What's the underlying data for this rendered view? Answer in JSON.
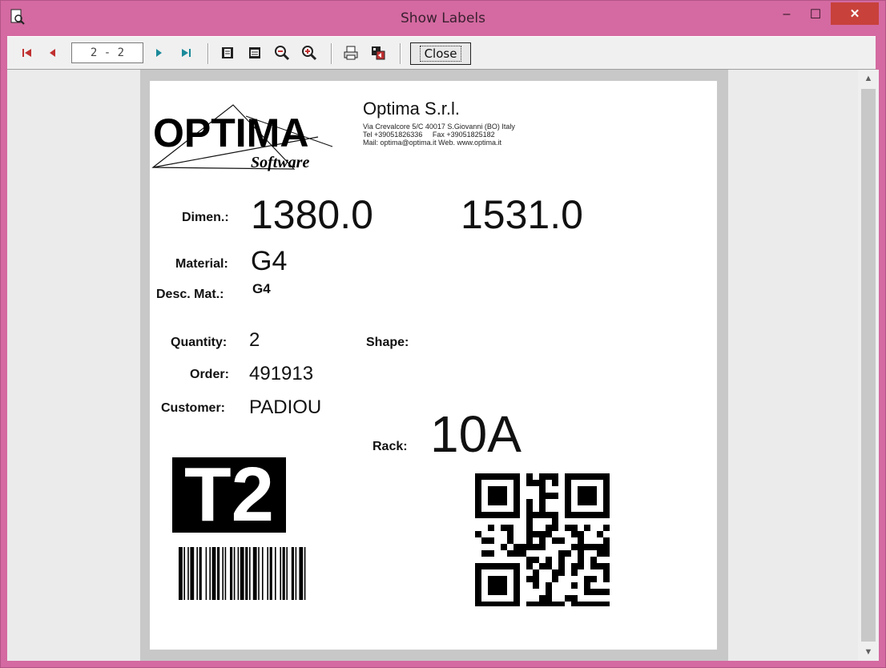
{
  "window": {
    "title": "Show Labels",
    "minimize_glyph": "–",
    "maximize_glyph": "☐",
    "close_glyph": "✕"
  },
  "toolbar": {
    "page_indicator": "2 - 2",
    "close_label": "Close",
    "icons": [
      "first-page-icon",
      "prev-page-icon",
      "next-page-icon",
      "last-page-icon",
      "fit-page-icon",
      "fit-width-icon",
      "zoom-out-icon",
      "zoom-in-icon",
      "print-icon",
      "export-icon"
    ]
  },
  "label": {
    "company": {
      "logo_text": "OPTIMA",
      "logo_sub": "Software",
      "name": "Optima S.r.l.",
      "address": "Via Crevalcore 5/C 40017 S.Giovanni (BO) Italy",
      "phone": "Tel +39051826336     Fax +39051825182",
      "mail": "Mail: optima@optima.it Web. www.optima.it"
    },
    "dimen_label": "Dimen.:",
    "dimen_1": "1380.0",
    "dimen_2": "1531.0",
    "material_label": "Material:",
    "material": "G4",
    "desc_label": "Desc. Mat.:",
    "desc": "G4",
    "quantity_label": "Quantity:",
    "quantity": "2",
    "shape_label": "Shape:",
    "shape": "",
    "order_label": "Order:",
    "order": "491913",
    "customer_label": "Customer:",
    "customer": "PADIOU",
    "rack_label": "Rack:",
    "rack": "10A",
    "tag": "T2"
  }
}
